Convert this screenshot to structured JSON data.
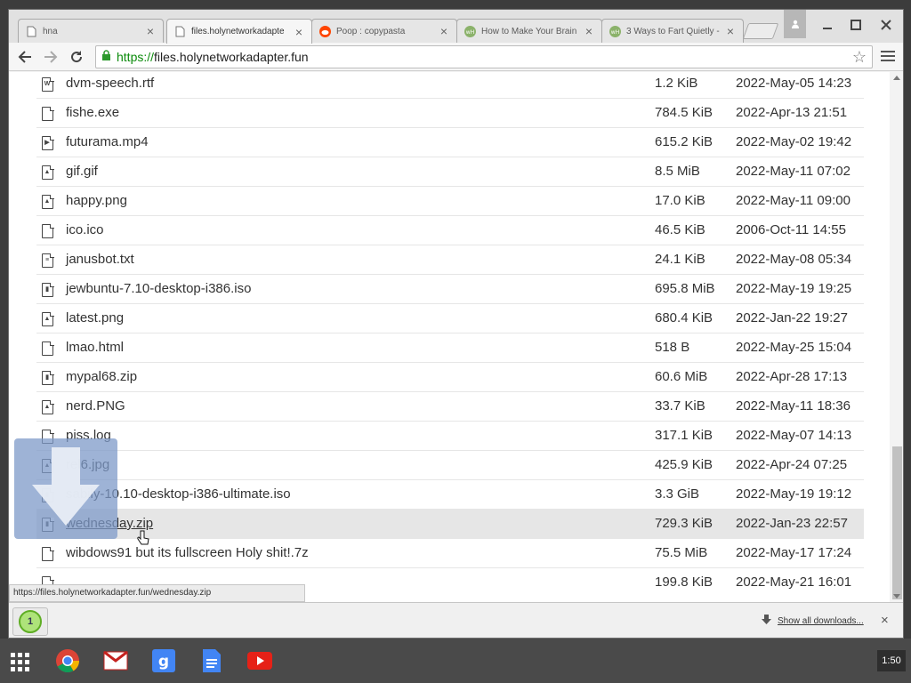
{
  "tabs": [
    {
      "title": "hna",
      "icon": "page-icon",
      "active": false
    },
    {
      "title": "files.holynetworkadapte",
      "icon": "page-icon",
      "active": true
    },
    {
      "title": "Poop : copypasta",
      "icon": "reddit-icon",
      "active": false
    },
    {
      "title": "How to Make Your Brain",
      "icon": "wikihow-icon",
      "active": false
    },
    {
      "title": "3 Ways to Fart Quietly -",
      "icon": "wikihow-icon",
      "active": false
    }
  ],
  "address": {
    "scheme": "https://",
    "host": "files.holynetworkadapter.fun"
  },
  "files": [
    {
      "name": "dvm-speech.rtf",
      "size": "1.2 KiB",
      "date": "2022-May-05 14:23",
      "icon": "word-doc-icon"
    },
    {
      "name": "fishe.exe",
      "size": "784.5 KiB",
      "date": "2022-Apr-13 21:51",
      "icon": "file-icon"
    },
    {
      "name": "futurama.mp4",
      "size": "615.2 KiB",
      "date": "2022-May-02 19:42",
      "icon": "video-file-icon"
    },
    {
      "name": "gif.gif",
      "size": "8.5 MiB",
      "date": "2022-May-11 07:02",
      "icon": "image-file-icon"
    },
    {
      "name": "happy.png",
      "size": "17.0 KiB",
      "date": "2022-May-11 09:00",
      "icon": "image-file-icon"
    },
    {
      "name": "ico.ico",
      "size": "46.5 KiB",
      "date": "2006-Oct-11 14:55",
      "icon": "file-icon"
    },
    {
      "name": "janusbot.txt",
      "size": "24.1 KiB",
      "date": "2022-May-08 05:34",
      "icon": "text-file-icon"
    },
    {
      "name": "jewbuntu-7.10-desktop-i386.iso",
      "size": "695.8 MiB",
      "date": "2022-May-19 19:25",
      "icon": "archive-file-icon"
    },
    {
      "name": "latest.png",
      "size": "680.4 KiB",
      "date": "2022-Jan-22 19:27",
      "icon": "image-file-icon"
    },
    {
      "name": "lmao.html",
      "size": "518 B",
      "date": "2022-May-25 15:04",
      "icon": "file-icon"
    },
    {
      "name": "mypal68.zip",
      "size": "60.6 MiB",
      "date": "2022-Apr-28 17:13",
      "icon": "archive-file-icon"
    },
    {
      "name": "nerd.PNG",
      "size": "33.7 KiB",
      "date": "2022-May-11 18:36",
      "icon": "image-file-icon"
    },
    {
      "name": "piss.log",
      "size": "317.1 KiB",
      "date": "2022-May-07 14:13",
      "icon": "file-icon"
    },
    {
      "name": "rel6.jpg",
      "size": "425.9 KiB",
      "date": "2022-Apr-24 07:25",
      "icon": "image-file-icon"
    },
    {
      "name": "sabily-10.10-desktop-i386-ultimate.iso",
      "size": "3.3 GiB",
      "date": "2022-May-19 19:12",
      "icon": "archive-file-icon"
    },
    {
      "name": "wednesday.zip",
      "size": "729.3 KiB",
      "date": "2022-Jan-23 22:57",
      "icon": "archive-file-icon",
      "hover": true
    },
    {
      "name": "wibdows91 but its fullscreen Holy shit!.7z",
      "size": "75.5 MiB",
      "date": "2022-May-17 17:24",
      "icon": "file-icon"
    },
    {
      "name": "",
      "size": "199.8 KiB",
      "date": "2022-May-21 16:01",
      "icon": "file-icon"
    }
  ],
  "status_url": "https://files.holynetworkadapter.fun/wednesday.zip",
  "download_bar": {
    "show_all_label": "Show all downloads...",
    "progress_label": "1"
  },
  "shelf": {
    "apps": [
      "chrome-icon",
      "gmail-icon",
      "google-search-icon",
      "docs-icon",
      "youtube-icon"
    ],
    "clock": "1:50"
  },
  "colors": {
    "accent_secure": "#0b8b0b",
    "hover_row": "#e6e6e6",
    "download_progress": "#aee37a"
  }
}
